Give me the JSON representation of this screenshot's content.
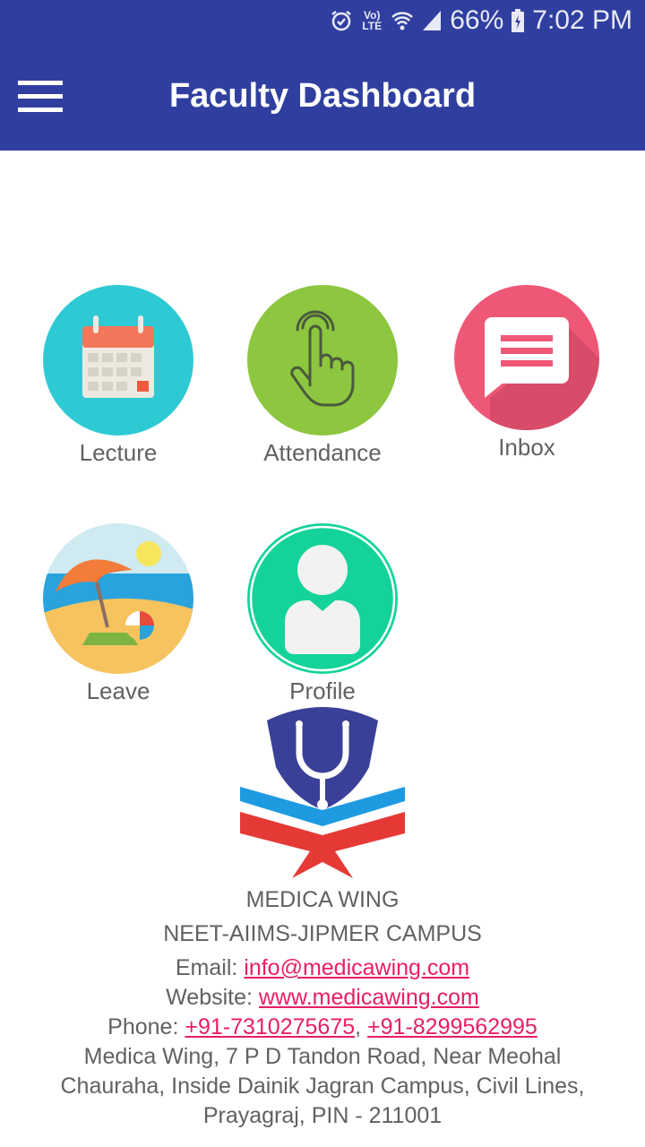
{
  "status": {
    "signal_text": "Vo) LTE",
    "battery": "66%",
    "time": "7:02 PM"
  },
  "appbar": {
    "title": "Faculty Dashboard"
  },
  "tiles": [
    {
      "label": "Lecture",
      "icon": "calendar-icon",
      "color": "#2ECAD4"
    },
    {
      "label": "Attendance",
      "icon": "tap-hand-icon",
      "color": "#8DC63F"
    },
    {
      "label": "Inbox",
      "icon": "message-icon",
      "color": "#EF5777"
    },
    {
      "label": "Leave",
      "icon": "beach-icon",
      "color": "#29B6F6"
    },
    {
      "label": "Profile",
      "icon": "user-icon",
      "color": "#14D39A"
    }
  ],
  "footer": {
    "org_name": "MEDICA WING",
    "campus": "NEET-AIIMS-JIPMER CAMPUS",
    "email_label": "Email: ",
    "email": "info@medicawing.com",
    "website_label": "Website: ",
    "website": "www.medicawing.com",
    "phone_label": "Phone: ",
    "phone1": "+91-7310275675",
    "phone_sep": ", ",
    "phone2": "+91-8299562995",
    "address_line1": "Medica Wing, 7 P D Tandon Road, Near Meohal",
    "address_line2": "Chauraha, Inside Dainik Jagran Campus, Civil Lines,",
    "address_line3": "Prayagraj, PIN - 211001"
  },
  "colors": {
    "primary": "#303F9F",
    "link": "#E91E63",
    "text": "#616161"
  }
}
